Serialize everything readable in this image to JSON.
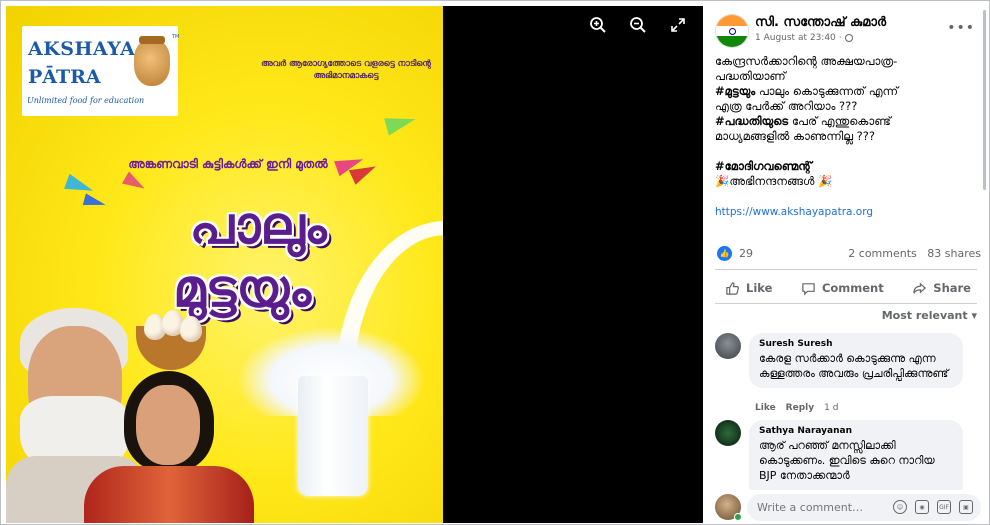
{
  "poster": {
    "logo_line1": "AKSHAYA",
    "logo_line2": "PĀTRA",
    "logo_tagline": "Unlimited food for education",
    "logo_tm": "TM",
    "tagline": "അവർ ആരോഗ്യത്തോടെ വളരട്ടെ നാടിന്റെ അഭിമാനമാകട്ടെ",
    "subtitle": "അങ്കണവാടി കുട്ടികൾക്ക് ഇനി മുതൽ",
    "headline1": "പാലും",
    "headline2": "മുട്ടയും"
  },
  "viewer_tools": {
    "zoom_in": "zoom-in-icon",
    "zoom_out": "zoom-out-icon",
    "fullscreen": "fullscreen-icon"
  },
  "post": {
    "author": "സി. സന്തോഷ് കുമാർ",
    "time": "1 August at 23:40",
    "privacy_sep": "·",
    "more": "•••",
    "lines": [
      "കേന്ദ്രസർക്കാറിന്റെ അക്ഷയപാത്ര-",
      "പദ്ധതിയാണ്"
    ],
    "hashtag1": "#മുട്ടയും",
    "line3_rest": " പാലും കൊടുക്കുന്നത് എന്ന്",
    "line4": "എത്ര പേർക്ക് അറിയാം ???",
    "hashtag2": "#പദ്ധതിയുടെ",
    "line5_rest": " പേര് എന്തുകൊണ്ട്",
    "line6": "മാധ്യമങ്ങളിൽ കാണുന്നില്ല ???",
    "hashtag3": "#മോദിഗവണ്മെന്റ്",
    "congrats": "🎉അഭിനന്ദനങ്ങൾ 🎉",
    "link": "https://www.akshayapatra.org"
  },
  "reactions": {
    "count": "29",
    "comments": "2 comments",
    "shares": "83 shares"
  },
  "actions": {
    "like": "Like",
    "comment": "Comment",
    "share": "Share"
  },
  "sort": {
    "label": "Most relevant ▾"
  },
  "comments": [
    {
      "name": "Suresh Suresh",
      "text": "കേരള സർക്കാർ കൊടുക്കുന്നു എന്ന കള്ളത്തരം അവരും പ്രചരിപ്പിക്കുന്നുണ്ട്",
      "like": "Like",
      "reply": "Reply",
      "time": "1 d"
    },
    {
      "name": "Sathya Narayanan",
      "text": "ആര് പറഞ്ഞ് മനസ്സിലാക്കി കൊടുക്കണം. ഇവിടെ കുറെ നാറിയ BJP നേതാക്കന്മാർ"
    }
  ],
  "composer": {
    "placeholder": "Write a comment…",
    "icons": [
      "emoji-icon",
      "camera-icon",
      "gif-icon",
      "sticker-icon"
    ]
  },
  "colors": {
    "poster_yellow": "#ffe81a",
    "headline_purple": "#5b1d8e",
    "link_blue": "#216fdb",
    "like_blue": "#1877f2"
  }
}
